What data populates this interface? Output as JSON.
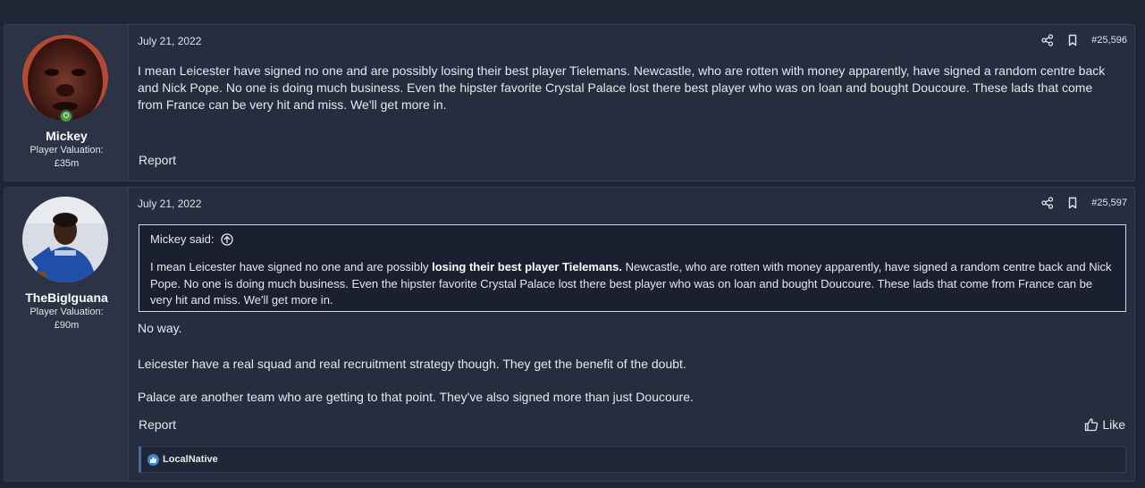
{
  "posts": [
    {
      "username": "Mickey",
      "valuation_label": "Player Valuation:",
      "valuation_value": "£35m",
      "date": "July 21, 2022",
      "post_number": "#25,596",
      "body": "I mean Leicester have signed no one and are possibly losing their best player Tielemans. Newcastle, who are rotten with money apparently, have signed a random centre back and Nick Pope. No one is doing much business. Even the hipster favorite Crystal Palace lost there best player who was on loan and bought Doucoure. These lads that come from France can be very hit and miss. We'll get more in.",
      "report_label": "Report"
    },
    {
      "username": "TheBigIguana",
      "valuation_label": "Player Valuation:",
      "valuation_value": "£90m",
      "date": "July 21, 2022",
      "post_number": "#25,597",
      "quote": {
        "author_said": "Mickey said:",
        "text_before": "I mean Leicester have signed no one and are possibly ",
        "text_bold": "losing their best player Tielemans.",
        "text_after": " Newcastle, who are rotten with money apparently, have signed a random centre back and Nick Pope. No one is doing much business. Even the hipster favorite Crystal Palace lost there best player who was on loan and bought Doucoure. These lads that come from France can be very hit and miss. We'll get more in."
      },
      "reply_lines": [
        "No way.",
        "Leicester have a real squad and real recruitment strategy though. They get the benefit of the doubt.",
        "Palace are another team who are getting to that point. They've also signed more than just Doucoure."
      ],
      "report_label": "Report",
      "like_label": "Like",
      "reactions_user": "LocalNative"
    }
  ],
  "icons": {
    "share": "share-icon",
    "bookmark": "bookmark-icon",
    "online": "online-status-icon",
    "quote_jump": "arrow-up-circle-icon",
    "like": "thumbs-up-icon",
    "reaction": "like-reaction-icon"
  },
  "colors": {
    "page_bg": "#1e2535",
    "post_bg": "#252d3f",
    "user_col_bg": "#2b3345",
    "online_green": "#4f9d3a",
    "reaction_blue": "#3d6fb0"
  }
}
